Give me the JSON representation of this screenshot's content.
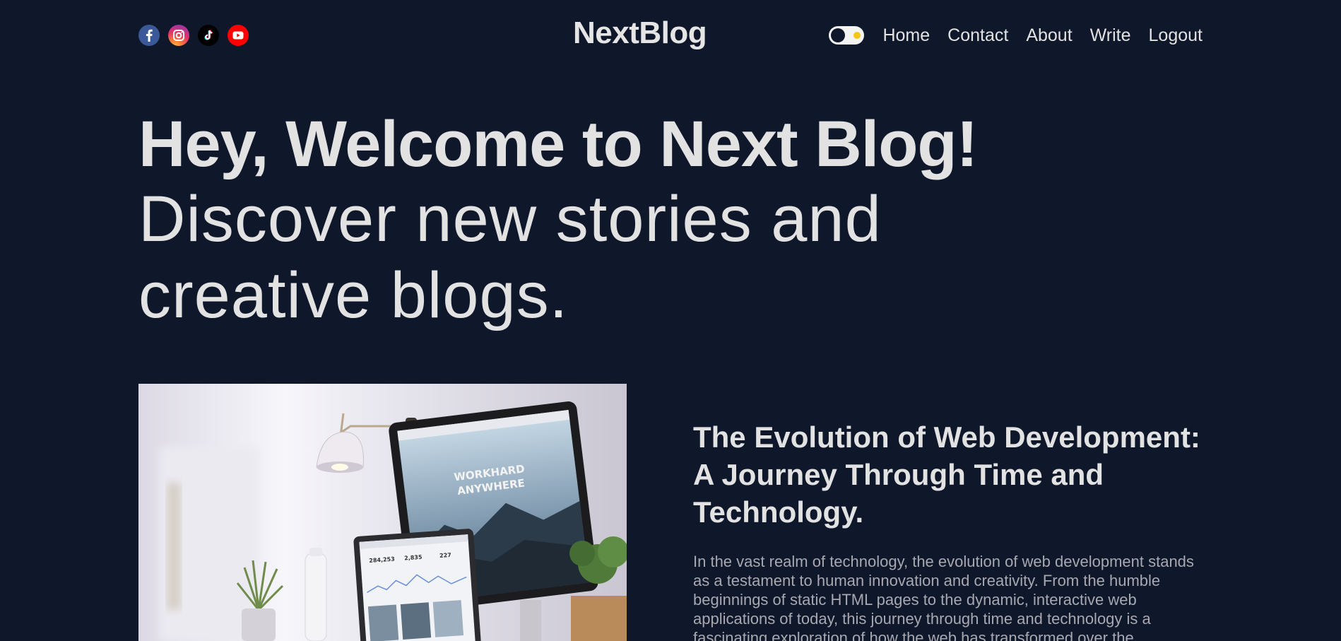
{
  "header": {
    "logo": "NextBlog",
    "socials": [
      {
        "name": "facebook",
        "icon": "facebook-icon",
        "color": "#3b5998"
      },
      {
        "name": "instagram",
        "icon": "instagram-icon",
        "color": "#e1306c"
      },
      {
        "name": "tiktok",
        "icon": "tiktok-icon",
        "color": "#010101"
      },
      {
        "name": "youtube",
        "icon": "youtube-icon",
        "color": "#ff0000"
      }
    ],
    "theme_toggle": {
      "state": "dark",
      "icon": "sun-icon"
    },
    "nav": [
      {
        "label": "Home"
      },
      {
        "label": "Contact"
      },
      {
        "label": "About"
      },
      {
        "label": "Write"
      },
      {
        "label": "Logout"
      }
    ]
  },
  "hero": {
    "title": "Hey, Welcome to Next Blog!",
    "subtitle": "Discover new stories and creative blogs."
  },
  "featured": {
    "image_text": {
      "line1": "WORKHARD",
      "line2": "ANYWHERE",
      "stat1": "284,253",
      "stat2": "2,835",
      "stat3": "227"
    },
    "title": "The Evolution of Web Development: A Journey Through Time and Technology.",
    "excerpt": "In the vast realm of technology, the evolution of web development stands as a testament to human innovation and creativity. From the humble beginnings of static HTML pages to the dynamic, interactive web applications of today, this journey through time and technology is a fascinating exploration of how the web has transformed over the"
  },
  "colors": {
    "background": "#0f172a",
    "text": "#e2e2e2",
    "muted_text": "#a8a8b0",
    "toggle_sun": "#f5c518"
  }
}
